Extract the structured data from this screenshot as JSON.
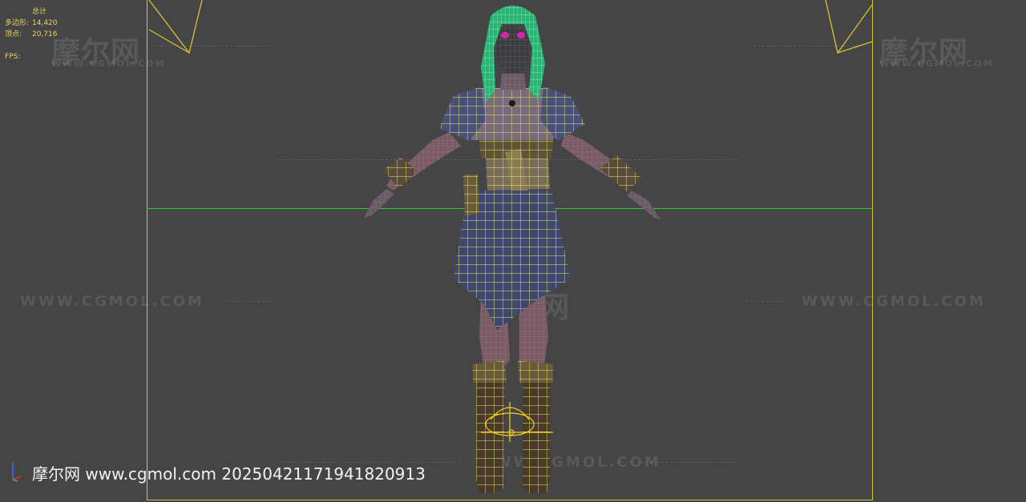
{
  "stats": {
    "title": "总计",
    "polygons_label": "多边形:",
    "polygons_value": "14,420",
    "vertices_label": "顶点:",
    "vertices_value": "20,716",
    "fps_label": "FPS:"
  },
  "watermarks": {
    "logo_text": "摩尔网",
    "logo_url": "WWW.CGMOL.COM",
    "url_text": "WWW.CGMOL.COM"
  },
  "footer": {
    "text": "摩尔网 www.cgmol.com 20250421171941820913"
  },
  "colors": {
    "background": "#454545",
    "safe_frame": "#d8c230",
    "horizon": "#37c837",
    "wire_selected": "#c8f060",
    "hair": "#3ed68e",
    "stats_text": "#e8d36a"
  }
}
